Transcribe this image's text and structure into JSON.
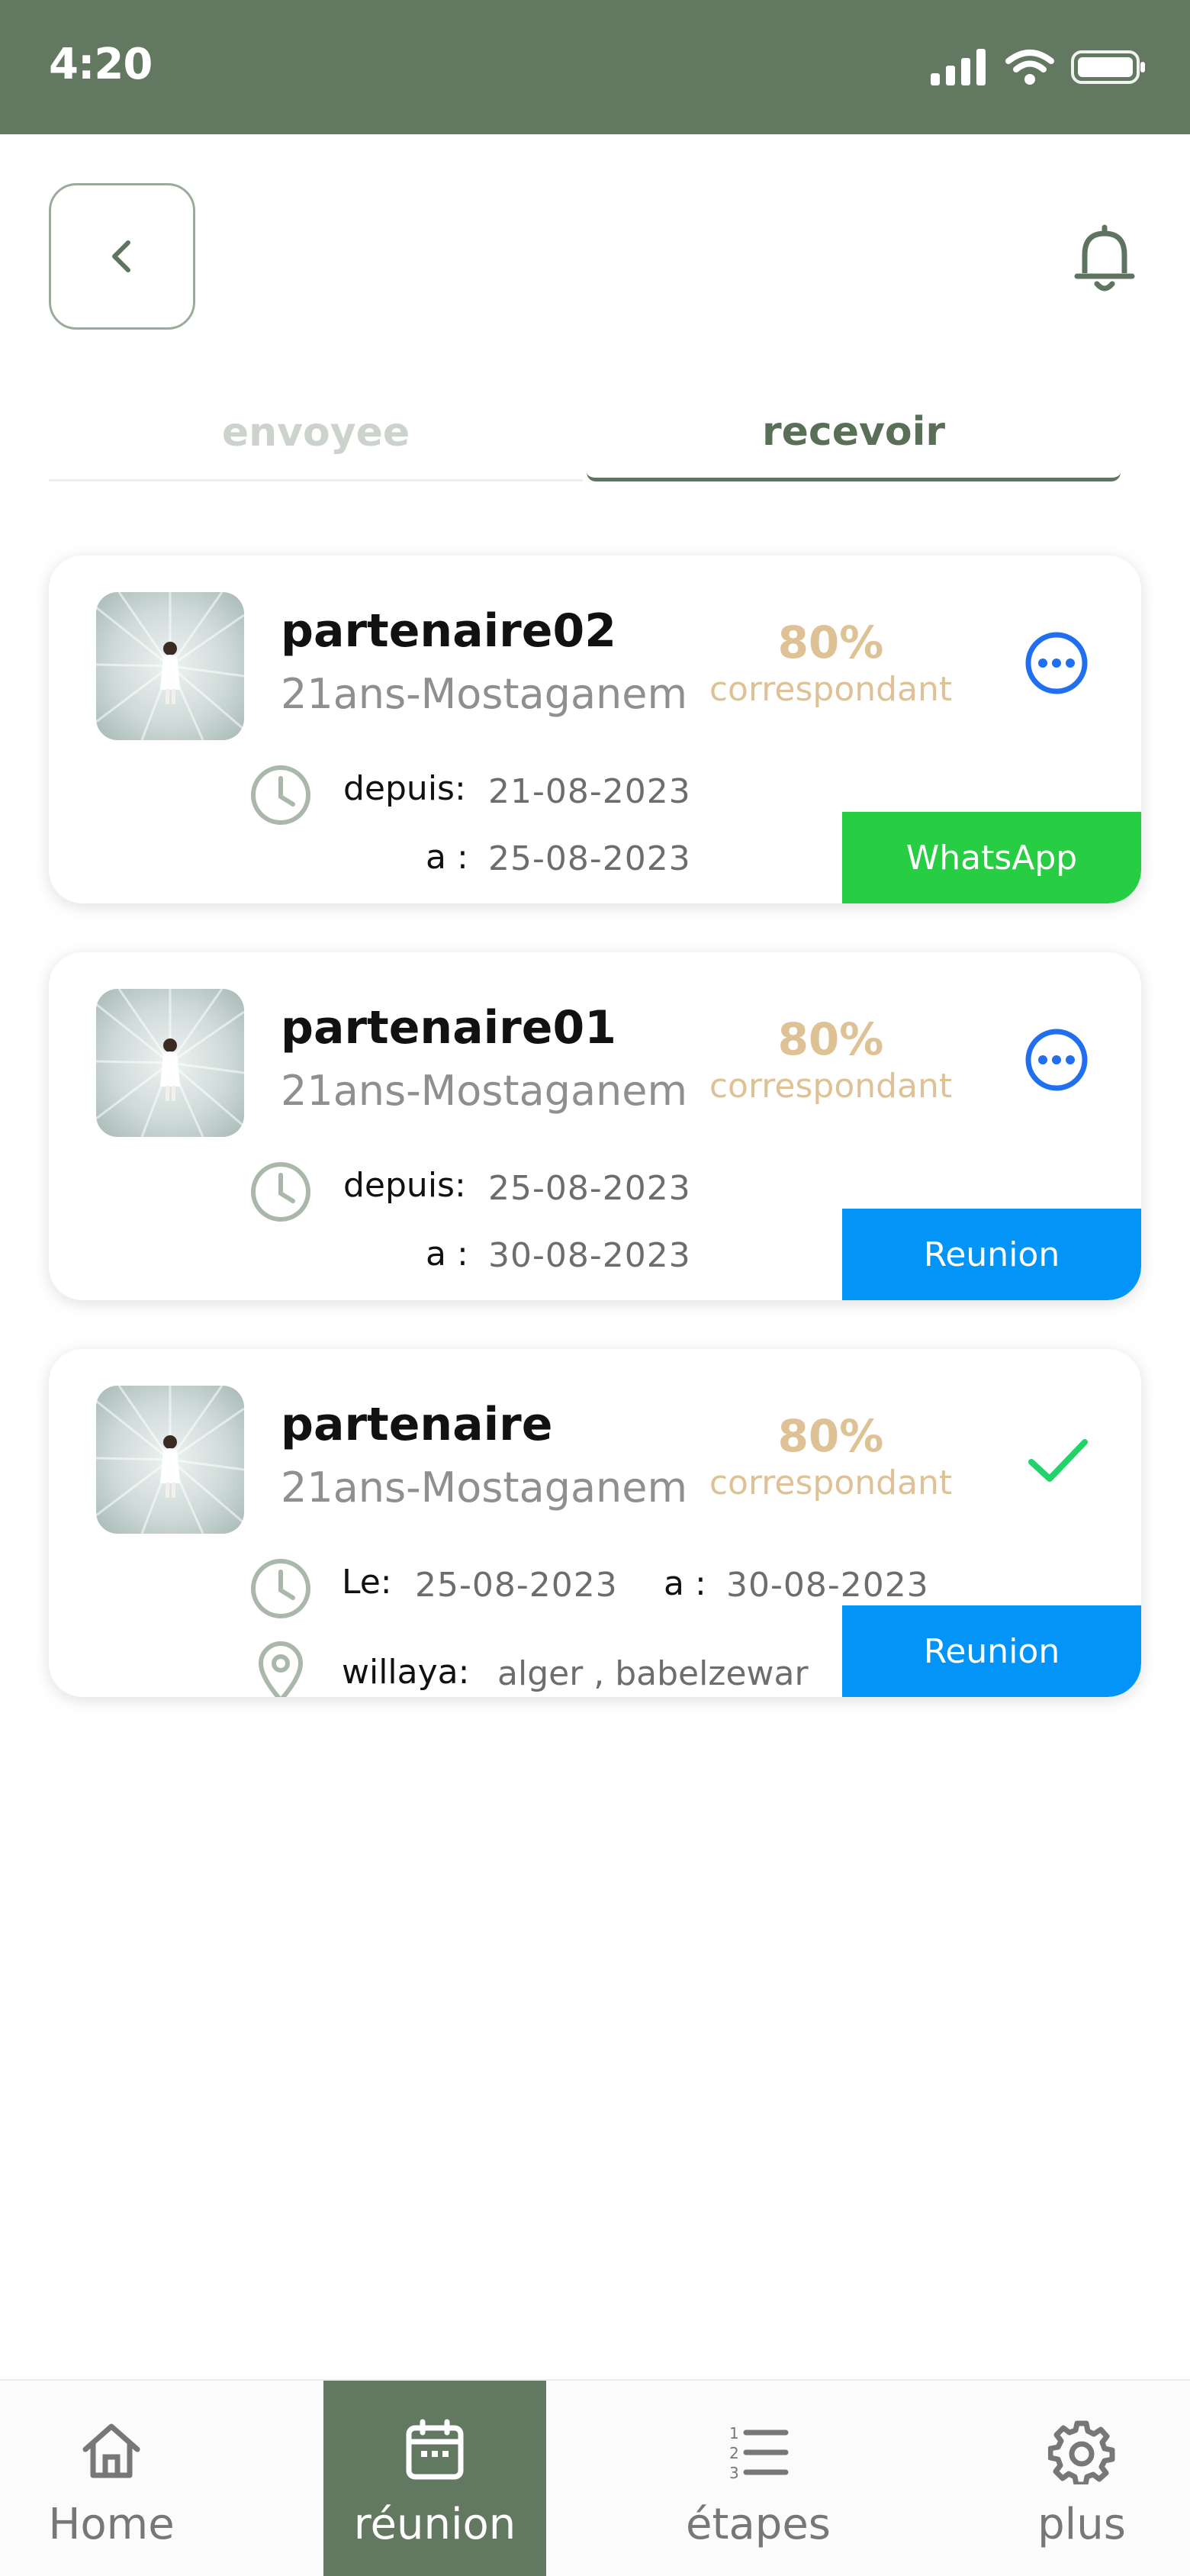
{
  "status_bar": {
    "time": "4:20"
  },
  "header": {
    "back_icon": "chevron-left-icon",
    "bell_icon": "bell-icon"
  },
  "tabs": [
    {
      "label": "envoyee",
      "active": false
    },
    {
      "label": "recevoir",
      "active": true
    }
  ],
  "cards": [
    {
      "name": "partenaire02",
      "subtitle": "21ans-Mostaganem",
      "match_percent": "80%",
      "match_label": "correspondant",
      "status_icon": "more-icon",
      "time_lines": [
        {
          "label": "depuis:",
          "value": "21-08-2023"
        },
        {
          "label": "a :",
          "value": "25-08-2023"
        }
      ],
      "action_label": "WhatsApp"
    },
    {
      "name": "partenaire01",
      "subtitle": "21ans-Mostaganem",
      "match_percent": "80%",
      "match_label": "correspondant",
      "status_icon": "more-icon",
      "time_lines": [
        {
          "label": "depuis:",
          "value": "25-08-2023"
        },
        {
          "label": "a :",
          "value": "30-08-2023"
        }
      ],
      "action_label": "Reunion"
    },
    {
      "name": "partenaire",
      "subtitle": "21ans-Mostaganem",
      "match_percent": "80%",
      "match_label": "correspondant",
      "status_icon": "check-icon",
      "le_label": "Le:",
      "le_value": "25-08-2023",
      "a_label": "a :",
      "a_value": "30-08-2023",
      "location_label": "willaya:",
      "location_value": "alger , babelzewar",
      "action_label": "Reunion"
    }
  ],
  "bottom_nav": [
    {
      "label": "Home",
      "icon": "home-icon",
      "active": false
    },
    {
      "label": "réunion",
      "icon": "calendar-icon",
      "active": true
    },
    {
      "label": "étapes",
      "icon": "numbered-list-icon",
      "active": false
    },
    {
      "label": "plus",
      "icon": "gear-icon",
      "active": false
    }
  ],
  "colors": {
    "primary_green": "#627860",
    "match_gold": "#dfc196",
    "whatsapp_green": "#27cd42",
    "reunion_blue": "#0394f8",
    "more_blue": "#1f6ff0",
    "check_green": "#20d46a"
  }
}
